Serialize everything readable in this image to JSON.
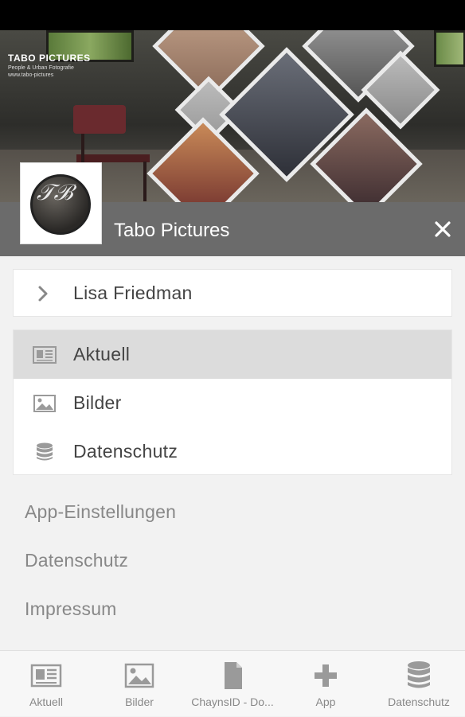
{
  "header": {
    "brand_line1": "TABO PICTURES",
    "brand_line2": "People & Urban Fotografie",
    "brand_line3": "www.tabo-pictures",
    "title": "Tabo Pictures",
    "close_icon": "close-icon"
  },
  "user": {
    "name": "Lisa Friedman",
    "icon": "chevron-right-icon"
  },
  "menu": {
    "items": [
      {
        "label": "Aktuell",
        "icon": "newspaper-icon",
        "active": true
      },
      {
        "label": "Bilder",
        "icon": "image-icon",
        "active": false
      },
      {
        "label": "Datenschutz",
        "icon": "database-icon",
        "active": false
      }
    ]
  },
  "links": [
    {
      "label": "App-Einstellungen"
    },
    {
      "label": "Datenschutz"
    },
    {
      "label": "Impressum"
    }
  ],
  "bottom_nav": {
    "items": [
      {
        "label": "Aktuell",
        "icon": "newspaper-icon"
      },
      {
        "label": "Bilder",
        "icon": "image-icon"
      },
      {
        "label": "ChaynsID - Do...",
        "icon": "document-icon"
      },
      {
        "label": "App",
        "icon": "plus-icon"
      },
      {
        "label": "Datenschutz",
        "icon": "database-icon"
      }
    ]
  },
  "colors": {
    "title_bar": "#6b6b6b",
    "active_item": "#dcdcdc",
    "background": "#f2f2f2",
    "icon_gray": "#9a9a9a"
  }
}
